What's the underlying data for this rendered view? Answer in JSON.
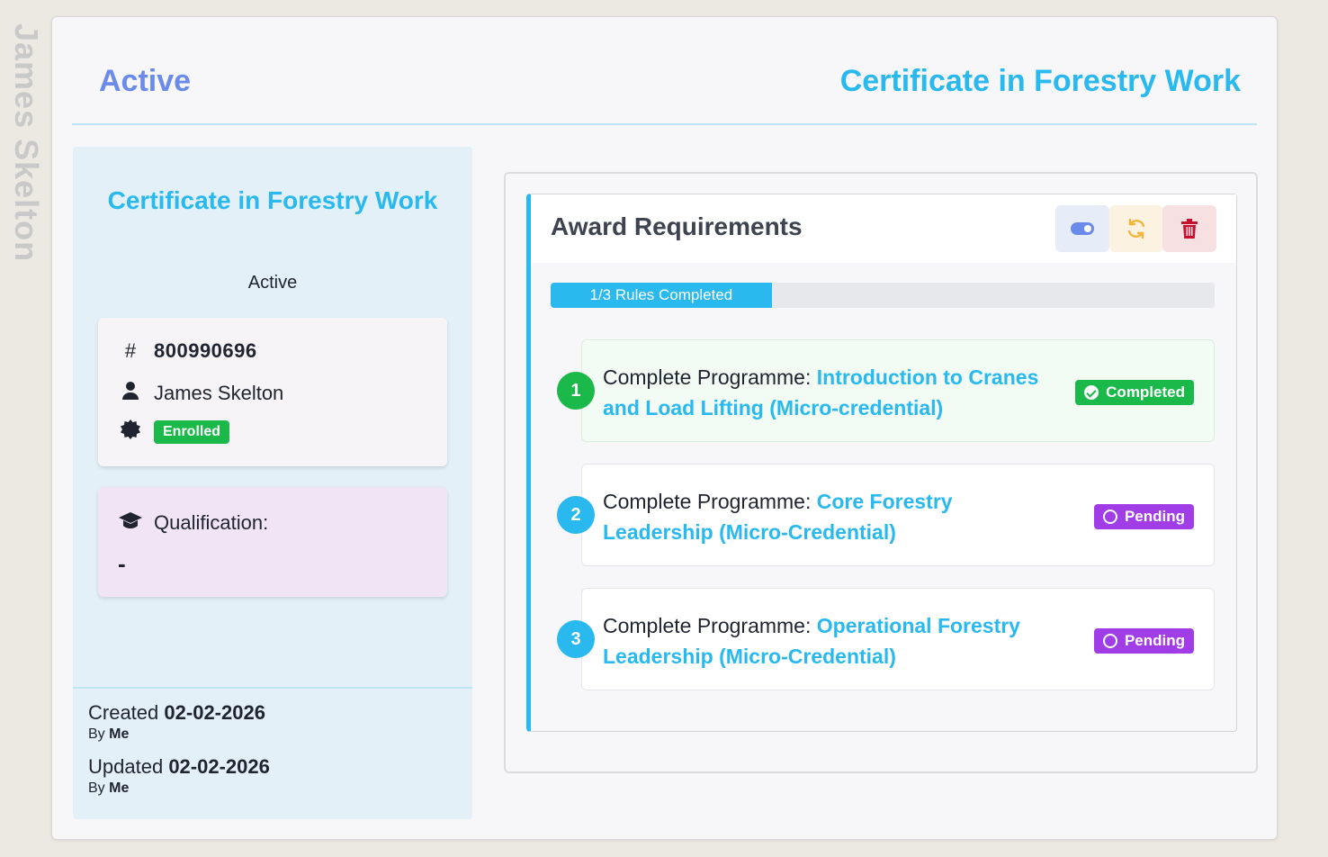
{
  "sidebar_name": "James Skelton",
  "header": {
    "status": "Active",
    "title": "Certificate in Forestry Work"
  },
  "left": {
    "title": "Certificate in Forestry Work",
    "status": "Active",
    "id_number": "800990696",
    "student_name": "James Skelton",
    "enrolment_badge": "Enrolled",
    "qualification_label": "Qualification:",
    "qualification_value": "-",
    "created_label": "Created",
    "created_date": "02-02-2026",
    "created_by_label": "By",
    "created_by": "Me",
    "updated_label": "Updated",
    "updated_date": "02-02-2026",
    "updated_by_label": "By",
    "updated_by": "Me"
  },
  "award": {
    "title": "Award Requirements",
    "progress_label": "1/3 Rules Completed",
    "progress_fraction": 0.333,
    "rules": [
      {
        "number": "1",
        "prefix": "Complete Programme:",
        "programme": "Introduction to Cranes and Load Lifting (Micro-credential)",
        "status": "Completed"
      },
      {
        "number": "2",
        "prefix": "Complete Programme:",
        "programme": "Core Forestry Leadership (Micro-Credential)",
        "status": "Pending"
      },
      {
        "number": "3",
        "prefix": "Complete Programme:",
        "programme": "Operational Forestry Leadership (Micro-Credential)",
        "status": "Pending"
      }
    ]
  },
  "colors": {
    "accent": "#29b9ee",
    "status_blue": "#6a8bea",
    "success": "#1bb84a",
    "pending": "#a13de6",
    "danger": "#c8102e"
  },
  "icons": [
    "hash-icon",
    "user-icon",
    "certificate-icon",
    "graduation-cap-icon",
    "toggle-icon",
    "refresh-icon",
    "trash-icon",
    "check-circle-icon",
    "circle-icon"
  ]
}
